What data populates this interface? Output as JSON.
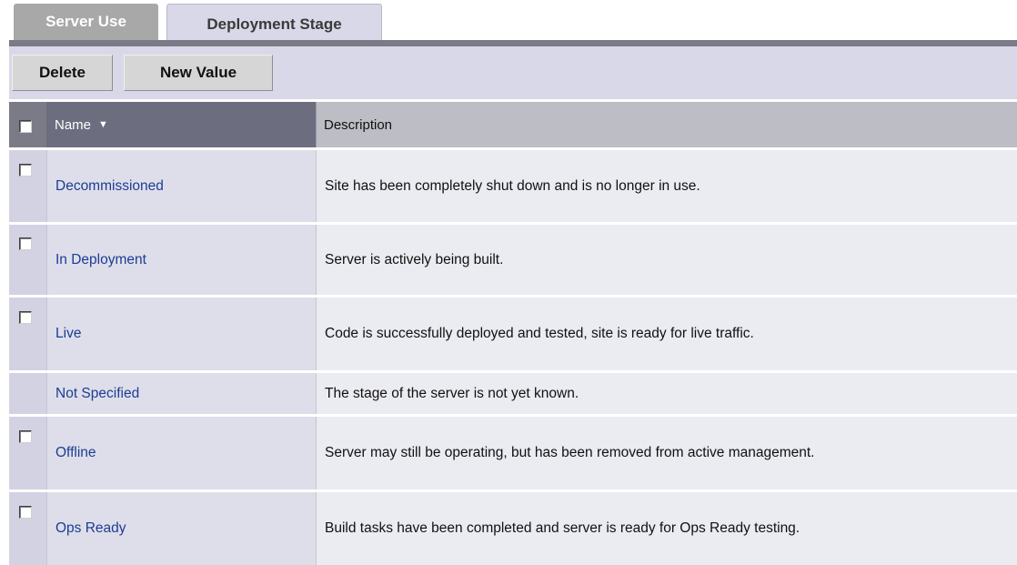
{
  "tabs": {
    "server_use": "Server Use",
    "deployment_stage": "Deployment Stage"
  },
  "toolbar": {
    "delete_label": "Delete",
    "new_value_label": "New Value"
  },
  "table": {
    "columns": {
      "name": "Name",
      "description": "Description"
    },
    "sort_indicator": "▼",
    "rows": [
      {
        "name": "Decommissioned",
        "description": "Site has been completely shut down and is no longer in use.",
        "has_checkbox": true
      },
      {
        "name": "In Deployment",
        "description": "Server is actively being built.",
        "has_checkbox": true
      },
      {
        "name": "Live",
        "description": "Code is successfully deployed and tested, site is ready for live traffic.",
        "has_checkbox": true
      },
      {
        "name": "Not Specified",
        "description": "The stage of the server is not yet known.",
        "has_checkbox": false
      },
      {
        "name": "Offline",
        "description": "Server may still be operating, but has been removed from active management.",
        "has_checkbox": true
      },
      {
        "name": "Ops Ready",
        "description": "Build tasks have been completed and server is ready for Ops Ready testing.",
        "has_checkbox": true
      }
    ]
  }
}
